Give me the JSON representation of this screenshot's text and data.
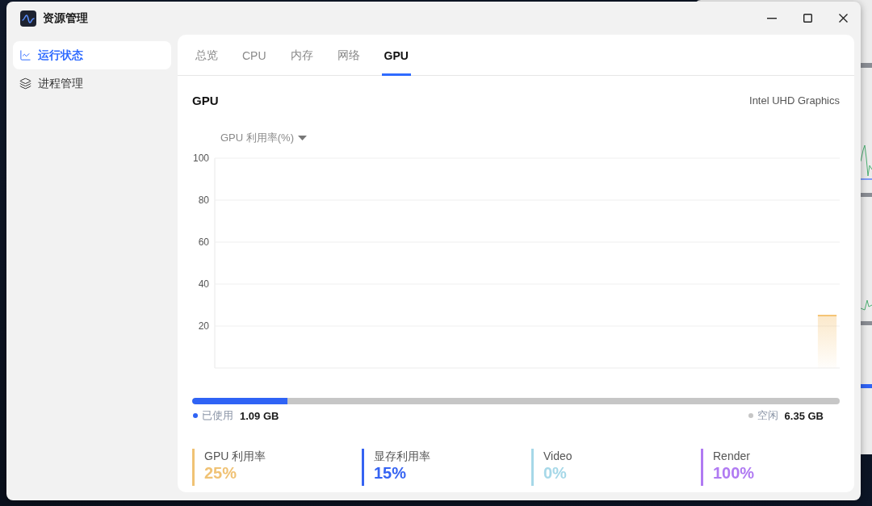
{
  "window": {
    "title": "资源管理"
  },
  "sidebar": {
    "items": [
      {
        "label": "运行状态",
        "selected": true,
        "kind": "chart"
      },
      {
        "label": "进程管理",
        "selected": false,
        "kind": "layers"
      }
    ]
  },
  "tabs": [
    {
      "label": "总览",
      "selected": false
    },
    {
      "label": "CPU",
      "selected": false
    },
    {
      "label": "内存",
      "selected": false
    },
    {
      "label": "网络",
      "selected": false
    },
    {
      "label": "GPU",
      "selected": true
    }
  ],
  "panel": {
    "title": "GPU",
    "device": "Intel UHD Graphics"
  },
  "chart": {
    "metric_select": "GPU 利用率(%)",
    "chart_data": {
      "type": "area",
      "grid": true,
      "categories": [
        null,
        null,
        null,
        null,
        null,
        null,
        null,
        null,
        null,
        null,
        null,
        null,
        null,
        null,
        null,
        null,
        null,
        null,
        null,
        null,
        null,
        null,
        null,
        null,
        null,
        null,
        null,
        null,
        null,
        null,
        null,
        null,
        null,
        null,
        null,
        null,
        null,
        null,
        null,
        null,
        null,
        null,
        null,
        null,
        null,
        null,
        null,
        null,
        null,
        null,
        null,
        null,
        null,
        null,
        null,
        null,
        null,
        null,
        null,
        null,
        null,
        null,
        null,
        null,
        null,
        null,
        null,
        null,
        null,
        null,
        null,
        null,
        null,
        null,
        null,
        null,
        null,
        null,
        null,
        null,
        null,
        null,
        null,
        null,
        null,
        null,
        null,
        null,
        null,
        null,
        null,
        null,
        null,
        null,
        null,
        null,
        null,
        null,
        null,
        null
      ],
      "ylim": [
        0,
        100
      ],
      "yticks": [
        20,
        40,
        60,
        80,
        100
      ],
      "series": [
        {
          "color": "#f2b450",
          "values": [
            null,
            null,
            null,
            null,
            null,
            null,
            null,
            null,
            null,
            null,
            null,
            null,
            null,
            null,
            null,
            null,
            null,
            null,
            null,
            null,
            null,
            null,
            null,
            null,
            null,
            null,
            null,
            null,
            null,
            null,
            null,
            null,
            null,
            null,
            null,
            null,
            null,
            null,
            null,
            null,
            null,
            null,
            null,
            null,
            null,
            null,
            null,
            null,
            null,
            null,
            null,
            null,
            null,
            null,
            null,
            null,
            null,
            null,
            null,
            null,
            null,
            null,
            null,
            null,
            null,
            null,
            null,
            null,
            null,
            null,
            null,
            null,
            null,
            null,
            null,
            null,
            null,
            null,
            null,
            null,
            null,
            null,
            null,
            null,
            null,
            null,
            null,
            null,
            null,
            null,
            null,
            null,
            null,
            null,
            null,
            null,
            25,
            25,
            25,
            25
          ]
        }
      ]
    }
  },
  "memory": {
    "level": 0.147,
    "used_label": "已使用",
    "used": "1.09 GB",
    "free_label": "空闲",
    "free": "6.35 GB"
  },
  "stats": [
    {
      "label": "GPU 利用率",
      "value": "25%",
      "color": "#f0c274"
    },
    {
      "label": "显存利用率",
      "value": "15%",
      "color": "#3563f2"
    },
    {
      "label": "Video",
      "value": "0%",
      "color": "#a6d8e8"
    },
    {
      "label": "Render",
      "value": "100%",
      "color": "#b07af2"
    }
  ]
}
